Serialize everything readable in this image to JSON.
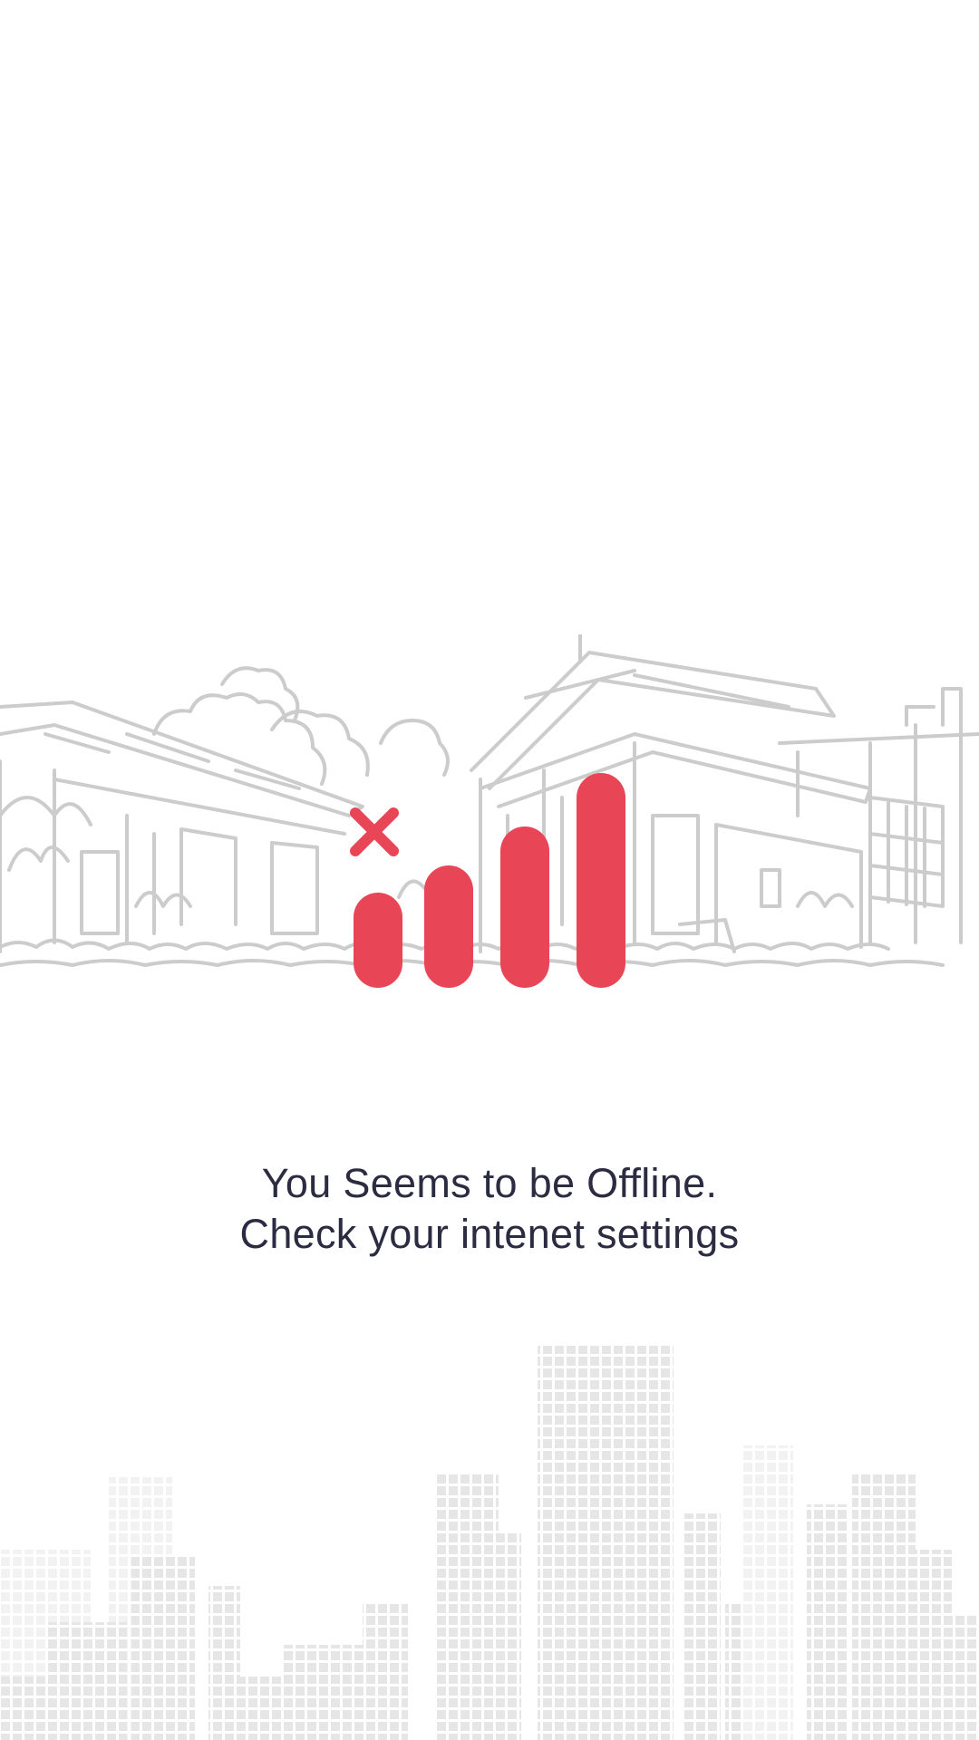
{
  "message": {
    "line1": "You Seems to be Offline.",
    "line2": "Check your intenet settings"
  },
  "icons": {
    "illustration": "village-sketch-illustration",
    "status": "no-signal-icon",
    "background": "city-skyline-pattern"
  },
  "colors": {
    "background": "#ffffff",
    "accent": "#e84657",
    "text": "#2b2b42",
    "sketch": "#cccccc",
    "skyline": "#ebebeb"
  }
}
